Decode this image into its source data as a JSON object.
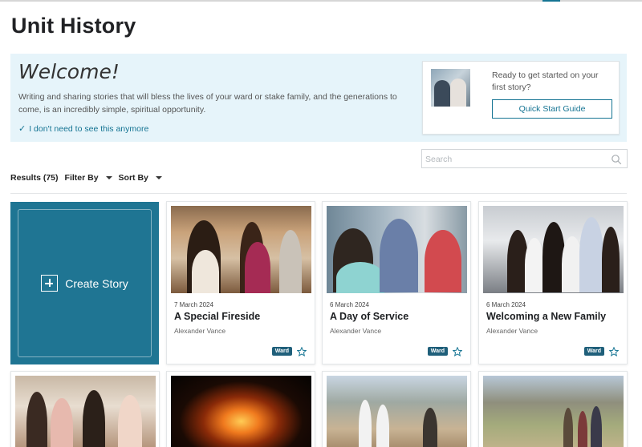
{
  "page": {
    "title": "Unit History"
  },
  "welcome": {
    "heading": "Welcome!",
    "text": "Writing and sharing stories that will bless the lives of your ward or stake family, and the generations to come, is an incredibly simple, spiritual opportunity.",
    "dismiss": "I don't need to see this anymore"
  },
  "quick_start": {
    "text": "Ready to get started on your first story?",
    "button": "Quick Start Guide"
  },
  "search": {
    "placeholder": "Search"
  },
  "toolbar": {
    "results": "Results (75)",
    "filter": "Filter By",
    "sort": "Sort By"
  },
  "create": {
    "label": "Create Story"
  },
  "stories": [
    {
      "date": "7 March 2024",
      "title": "A Special Fireside",
      "author": "Alexander Vance",
      "badge": "Ward"
    },
    {
      "date": "6 March 2024",
      "title": "A Day of Service",
      "author": "Alexander Vance",
      "badge": "Ward"
    },
    {
      "date": "6 March 2024",
      "title": "Welcoming a New Family",
      "author": "Alexander Vance",
      "badge": "Ward"
    }
  ],
  "colors": {
    "accent": "#157493",
    "create_bg": "#1f7593",
    "welcome_bg": "#e6f4fa",
    "badge_bg": "#1f5f7a"
  }
}
